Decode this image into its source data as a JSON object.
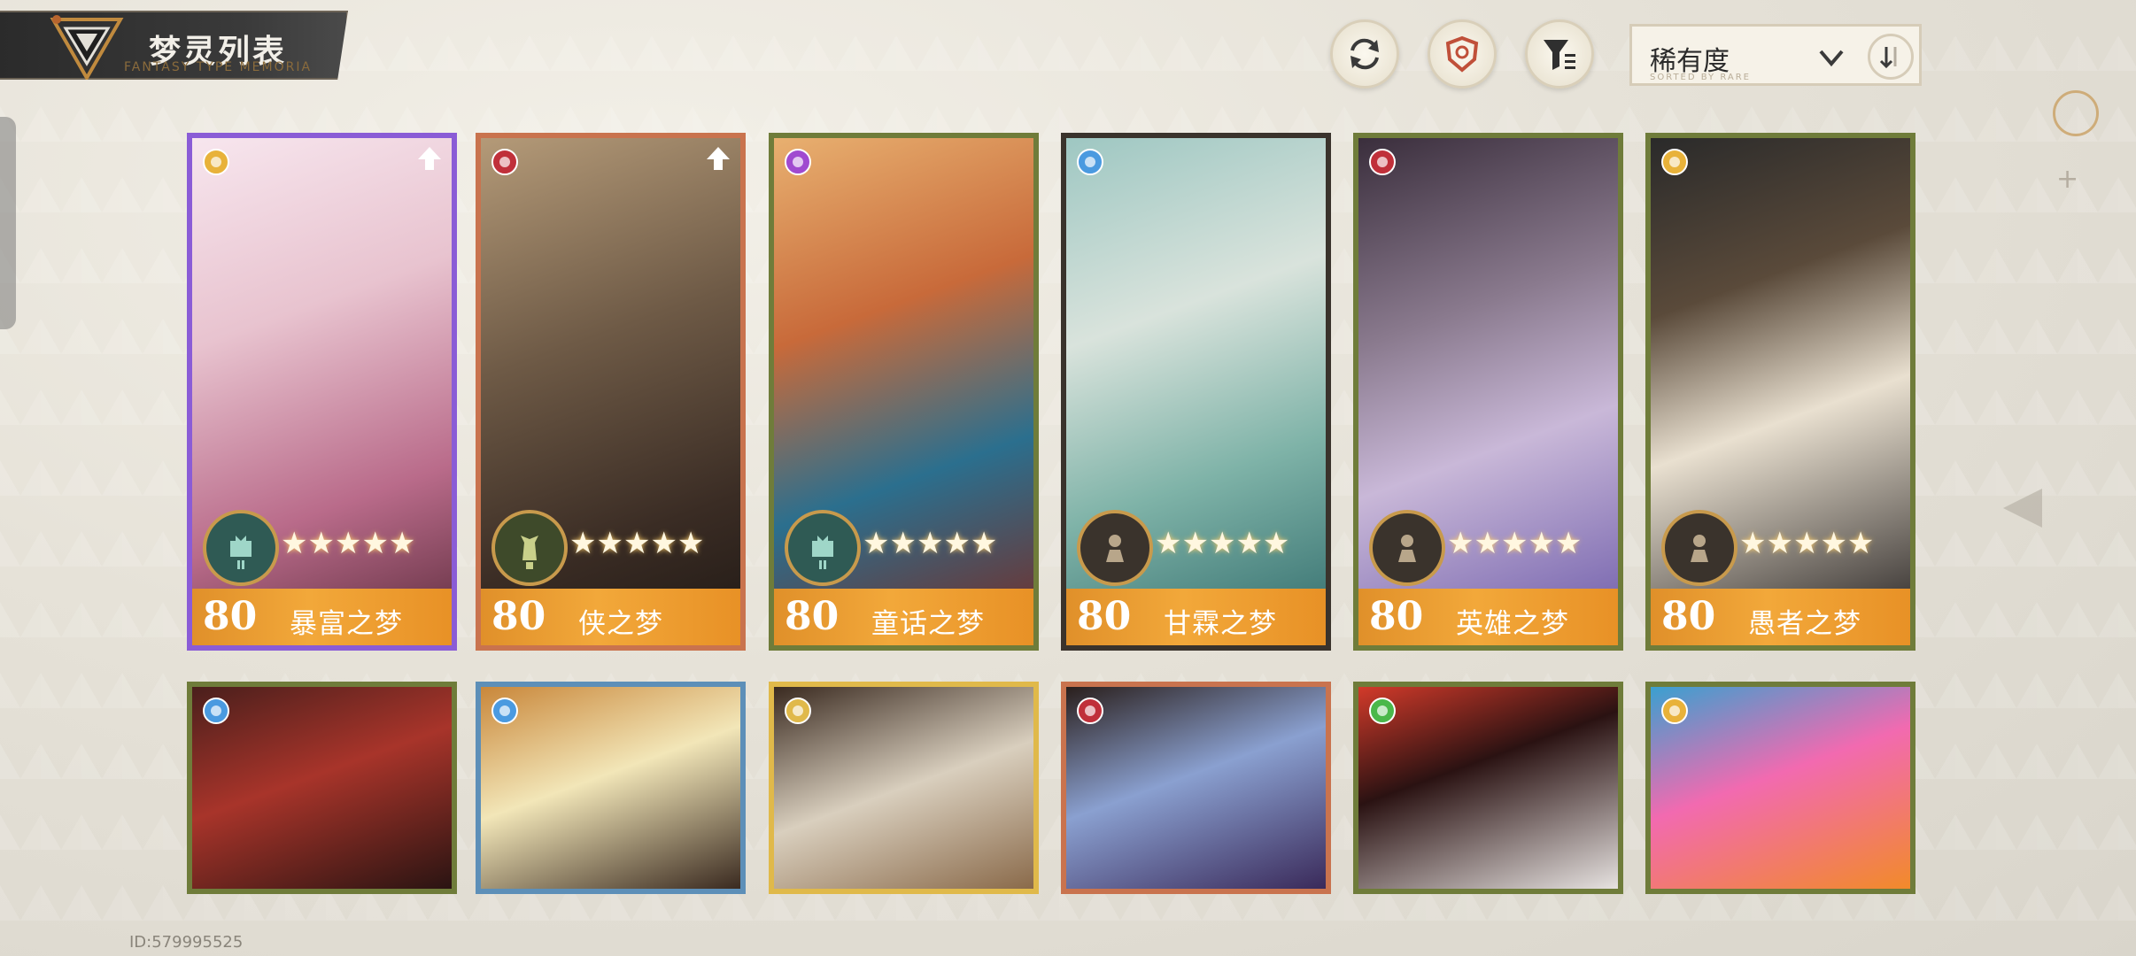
{
  "header": {
    "title": "梦灵列表",
    "subtitle": "FANTASY TYPE MEMORIA"
  },
  "toolbar": {
    "refresh_icon": "refresh-icon",
    "shield_icon": "shield-icon",
    "filter_icon": "filter-icon",
    "sort_label": "稀有度",
    "sort_sub": "SORTED BY RARE",
    "sort_chevron_icon": "chevron-down-icon",
    "sort_order_icon": "sort-order-icon"
  },
  "cards_row1": [
    {
      "level": "80",
      "name": "暴富之梦",
      "stars": "★★★★★",
      "element": "gold",
      "border": "#8a5cd6",
      "class": "castle",
      "upgrade": true
    },
    {
      "level": "80",
      "name": "侠之梦",
      "stars": "★★★★★",
      "element": "crimson",
      "border": "#c9734e",
      "class": "king",
      "upgrade": true
    },
    {
      "level": "80",
      "name": "童话之梦",
      "stars": "★★★★★",
      "element": "violet",
      "border": "#6f7c3a",
      "class": "castle",
      "upgrade": false
    },
    {
      "level": "80",
      "name": "甘霖之梦",
      "stars": "★★★★★",
      "element": "azure",
      "border": "#3a332c",
      "class": "pawn",
      "upgrade": false
    },
    {
      "level": "80",
      "name": "英雄之梦",
      "stars": "★★★★★",
      "element": "crimson",
      "border": "#6f7c3a",
      "class": "pawn",
      "upgrade": false
    },
    {
      "level": "80",
      "name": "愚者之梦",
      "stars": "★★★★★",
      "element": "gold",
      "border": "#6f7c3a",
      "class": "pawn",
      "upgrade": false
    }
  ],
  "cards_row2": [
    {
      "element": "azure",
      "border": "#6f7c3a"
    },
    {
      "element": "azure",
      "border": "#5d8fb8"
    },
    {
      "element": "sun",
      "border": "#e0b94a"
    },
    {
      "element": "crimson",
      "border": "#c9734e"
    },
    {
      "element": "green",
      "border": "#6f7c3a"
    },
    {
      "element": "gold",
      "border": "#6f7c3a"
    }
  ],
  "footer": {
    "id_text": "ID:579995525"
  },
  "colors": {
    "name_bar": "#f2a83a",
    "default_border": "#6f7c3a",
    "title_bg": "#2b2b2b"
  }
}
